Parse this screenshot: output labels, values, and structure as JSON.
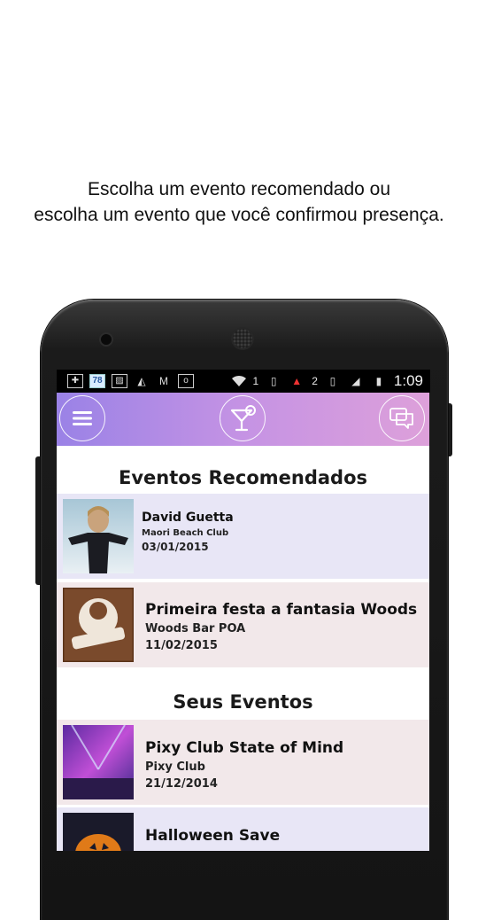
{
  "caption": {
    "line1": "Escolha um evento recomendado ou",
    "line2": "escolha um evento que você confirmou presença."
  },
  "statusbar": {
    "left_badge": "78",
    "sim1": "1",
    "sim2": "2",
    "time": "1:09"
  },
  "appbar": {
    "menu_icon": "hamburger-icon",
    "logo_icon": "cocktail-icon",
    "chat_icon": "chat-bubbles-icon",
    "accent_left": "#9a82e6",
    "accent_right": "#dda0da"
  },
  "recommended": {
    "title": "Eventos Recomendados",
    "items": [
      {
        "title": "David Guetta",
        "venue": "Maori Beach Club",
        "date": "03/01/2015"
      },
      {
        "title": "Primeira festa a fantasia Woods",
        "venue": "Woods Bar POA",
        "date": "11/02/2015"
      }
    ]
  },
  "yours": {
    "title": "Seus Eventos",
    "items": [
      {
        "title": "Pixy Club State of Mind",
        "venue": "Pixy Club",
        "date": "21/12/2014"
      },
      {
        "title": "Halloween Save"
      }
    ]
  }
}
